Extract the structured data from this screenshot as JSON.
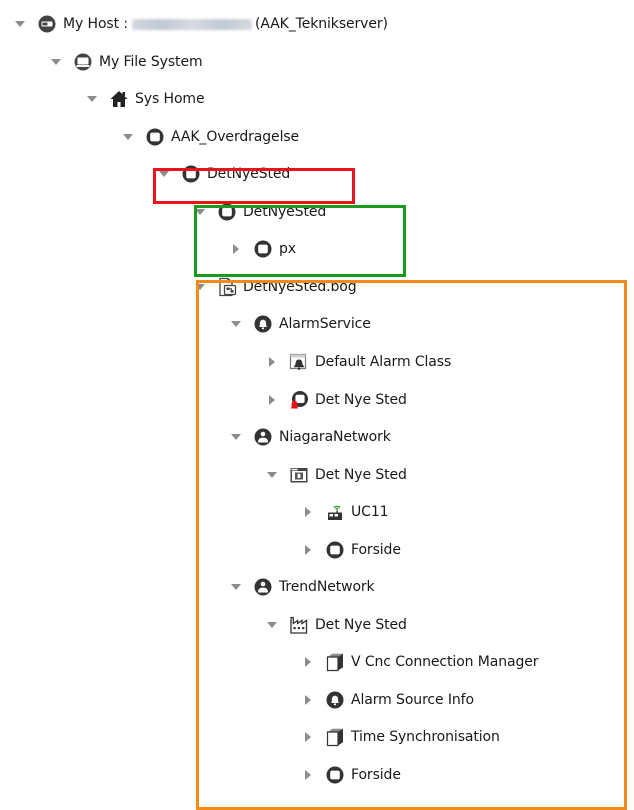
{
  "tree": [
    {
      "label": "My Host : ",
      "suffix": "(AAK_Teknikserver)",
      "redacted": true,
      "icon": "host-icon",
      "arrow": "expanded",
      "depth": 0
    },
    {
      "label": "My File System",
      "icon": "file-system-icon",
      "arrow": "expanded",
      "depth": 1
    },
    {
      "label": "Sys Home",
      "icon": "home-icon",
      "arrow": "expanded",
      "depth": 2
    },
    {
      "label": "AAK_Overdragelse",
      "icon": "folder-icon",
      "arrow": "expanded",
      "depth": 3
    },
    {
      "label": "DetNyeSted",
      "icon": "folder-icon",
      "arrow": "expanded",
      "depth": 4
    },
    {
      "label": "DetNyeSted",
      "icon": "folder-icon",
      "arrow": "expanded",
      "depth": 5
    },
    {
      "label": "px",
      "icon": "folder-icon",
      "arrow": "collapsed",
      "depth": 6
    },
    {
      "label": "DetNyeSted.bog",
      "icon": "bog-file-icon",
      "arrow": "expanded",
      "depth": 5
    },
    {
      "label": "AlarmService",
      "icon": "alarm-service-icon",
      "arrow": "expanded",
      "depth": 6
    },
    {
      "label": "Default Alarm Class",
      "icon": "alarm-class-icon",
      "arrow": "collapsed",
      "depth": 7
    },
    {
      "label": "Det Nye Sted",
      "icon": "alarm-folder-icon",
      "arrow": "collapsed",
      "depth": 7
    },
    {
      "label": "NiagaraNetwork",
      "icon": "network-icon",
      "arrow": "expanded",
      "depth": 6
    },
    {
      "label": "Det Nye Sted",
      "icon": "station-icon",
      "arrow": "expanded",
      "depth": 7
    },
    {
      "label": "UC11",
      "icon": "device-icon",
      "arrow": "collapsed",
      "depth": 8
    },
    {
      "label": "Forside",
      "icon": "folder-icon",
      "arrow": "collapsed",
      "depth": 8
    },
    {
      "label": "TrendNetwork",
      "icon": "network-icon",
      "arrow": "expanded",
      "depth": 6
    },
    {
      "label": "Det Nye Sted",
      "icon": "factory-icon",
      "arrow": "expanded",
      "depth": 7
    },
    {
      "label": "V Cnc Connection Manager",
      "icon": "cube-icon",
      "arrow": "collapsed",
      "depth": 8
    },
    {
      "label": "Alarm Source Info",
      "icon": "alarm-service-icon",
      "arrow": "collapsed",
      "depth": 8
    },
    {
      "label": "Time Synchronisation",
      "icon": "cube-icon",
      "arrow": "collapsed",
      "depth": 8
    },
    {
      "label": "Forside",
      "icon": "folder-icon",
      "arrow": "collapsed",
      "depth": 8
    }
  ],
  "highlights": [
    {
      "name": "red-highlight-box",
      "color": "#e8141c"
    },
    {
      "name": "green-highlight-box",
      "color": "#1a9a1f"
    },
    {
      "name": "orange-highlight-box",
      "color": "#f58a14"
    }
  ]
}
